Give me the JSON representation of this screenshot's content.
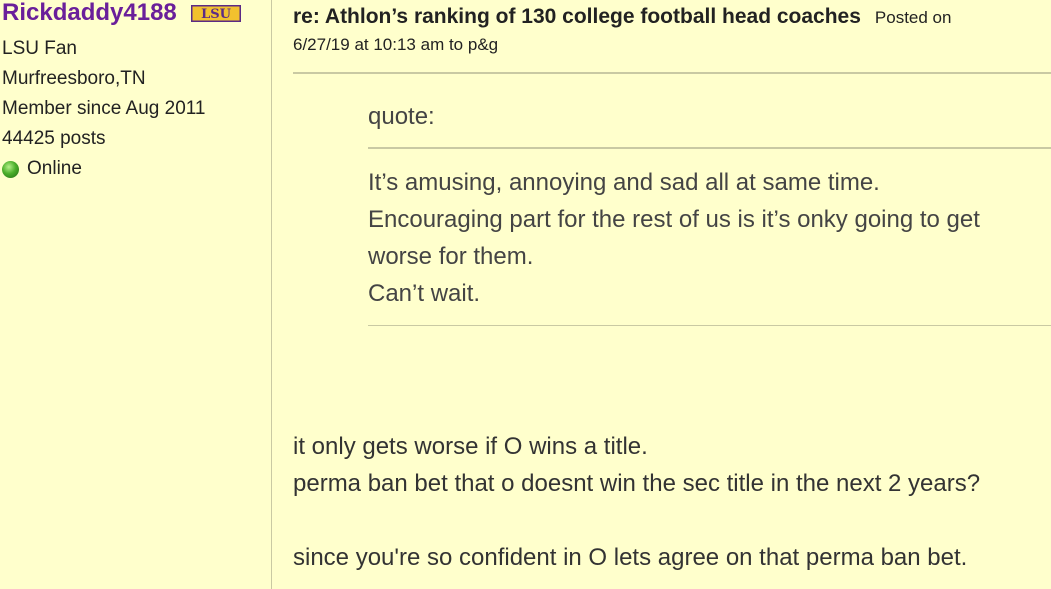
{
  "user": {
    "username": "Rickdaddy4188",
    "team_logo_text": "LSU",
    "fan_of": "LSU Fan",
    "location": "Murfreesboro,TN",
    "member_since": "Member since Aug 2011",
    "posts": "44425 posts",
    "status": "Online"
  },
  "post": {
    "title": "re: Athlon’s ranking of 130 college football head coaches",
    "posted_on_label": "Posted on",
    "date": "6/27/19 at 10:13 am to",
    "board": "p&g"
  },
  "quote": {
    "label": "quote:",
    "lines": [
      "It’s amusing, annoying and sad all at same time.",
      "Encouraging part for the rest of us is it’s onky going to get",
      "worse for them.",
      "Can’t wait."
    ]
  },
  "reply": {
    "lines": [
      "it only gets worse if O wins a title.",
      "perma ban bet that o doesnt win the sec title in the next 2 years?",
      "",
      "since you're so confident in O lets agree on that perma ban bet."
    ]
  },
  "colors": {
    "background": "#ffffcc",
    "username": "#6a1f9a",
    "logo_purple": "#5b2a86",
    "logo_gold": "#f2c12e"
  }
}
